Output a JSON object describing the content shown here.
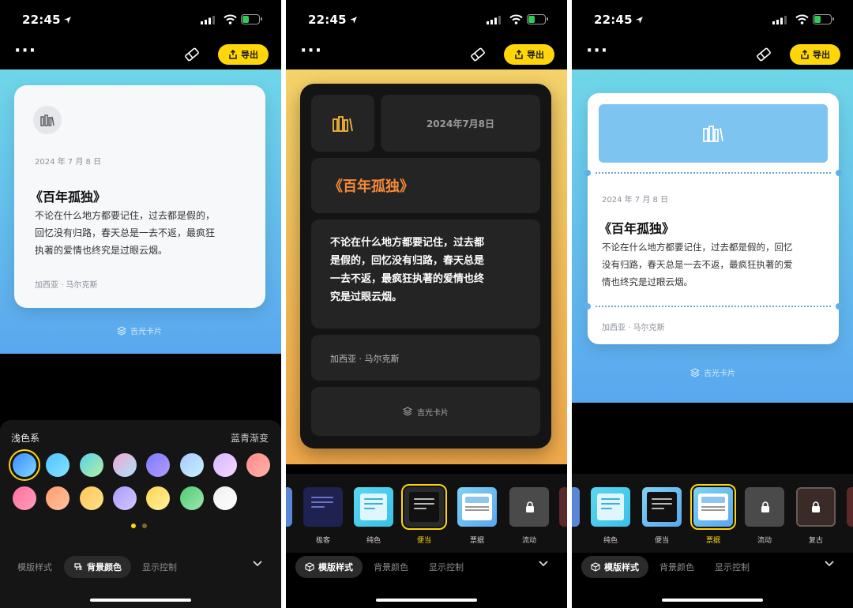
{
  "status": {
    "time": "22:45"
  },
  "toolbar": {
    "export_label": "导出"
  },
  "card": {
    "date": "2024年7月8日",
    "date_spaced": "2024 年 7 月 8 日",
    "title": "《百年孤独》",
    "quote": "不论在什么地方都要记住，过去都是假的，回忆没有归路，春天总是一去不返，最疯狂执著的爱情也终究是过眼云烟。",
    "quote_p1": [
      "不论在什么地方都要记住，过去都是假的，",
      "回忆没有归路，春天总是一去不返，最疯狂",
      "执著的爱情也终究是过眼云烟。"
    ],
    "quote_p2": [
      "不论在什么地方都要记住，过去都",
      "是假的，回忆没有归路，春天总是",
      "一去不返，最疯狂执著的爱情也终",
      "究是过眼云烟。"
    ],
    "quote_p3": [
      "不论在什么地方都要记住，过去都是假的，回忆",
      "没有归路，春天总是一去不返，最疯狂执著的爱",
      "情也终究是过眼云烟。"
    ],
    "author": "加西亚 · 马尔克斯",
    "brand": "吉光卡片"
  },
  "palette": {
    "category": "浅色系",
    "selected_name": "蓝青渐变",
    "swatches_row1": [
      "linear-gradient(135deg,#3a8bff,#7fd8ff)",
      "linear-gradient(135deg,#4fc3ff,#86e3ff)",
      "linear-gradient(135deg,#5ad1f0,#b2f0a0)",
      "linear-gradient(135deg,#f3a6d0,#a9e3ff)",
      "linear-gradient(135deg,#7a7bff,#b79bff)",
      "linear-gradient(135deg,#a7c9ff,#c8f0ff)",
      "linear-gradient(135deg,#d7b7ff,#f3d6ff)",
      "linear-gradient(135deg,#ff8a8a,#ffb3a7)"
    ],
    "swatches_row2": [
      "linear-gradient(135deg,#ff6f9a,#ff9ec0)",
      "linear-gradient(135deg,#ff9d6c,#ffc2a0)",
      "linear-gradient(135deg,#ffc65a,#ffe08a)",
      "linear-gradient(135deg,#a89bff,#d6c7ff)",
      "linear-gradient(135deg,#ffd54f,#fff0a0)",
      "linear-gradient(135deg,#4ecb71,#9ee8b0)",
      "linear-gradient(135deg,#f0f0f0,#ffffff)"
    ],
    "page_count": 2
  },
  "templates_p2": [
    "",
    "极客",
    "纯色",
    "便当",
    "票据",
    "流动",
    ""
  ],
  "templates_p3": [
    "纯色",
    "便当",
    "票据",
    "流动",
    "复古"
  ],
  "tabs": {
    "template": "模版样式",
    "background": "背景颜色",
    "display": "显示控制"
  },
  "colors": {
    "accent": "#ffd60a",
    "title_orange": "#f58a3a"
  }
}
